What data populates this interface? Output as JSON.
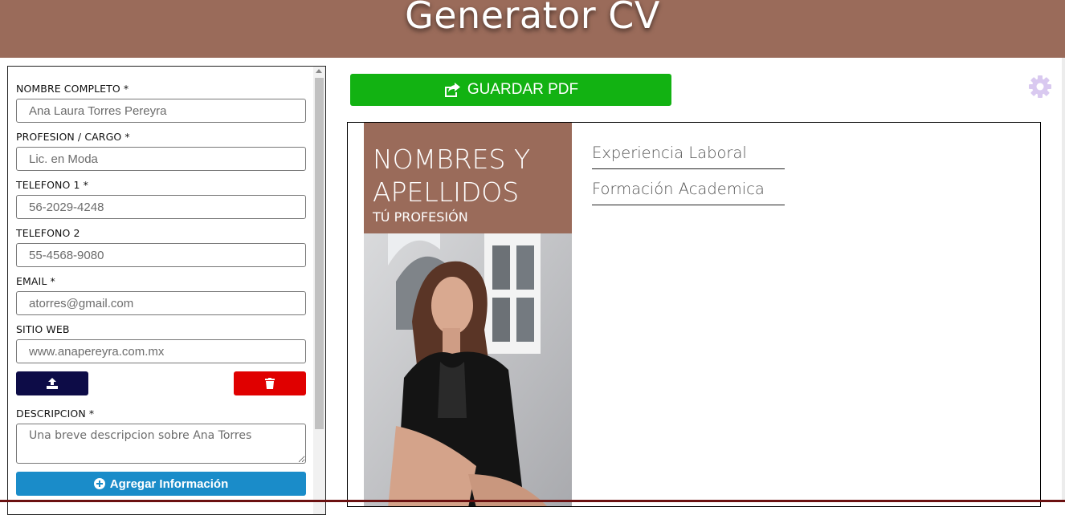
{
  "header": {
    "title": "Generator CV"
  },
  "form": {
    "fields": [
      {
        "label": "NOMBRE COMPLETO *",
        "placeholder": "Ana Laura Torres Pereyra"
      },
      {
        "label": "PROFESION / CARGO *",
        "placeholder": "Lic. en Moda"
      },
      {
        "label": "TELEFONO 1 *",
        "placeholder": "56-2029-4248"
      },
      {
        "label": "TELEFONO 2",
        "placeholder": "55-4568-9080"
      },
      {
        "label": "EMAIL *",
        "placeholder": "atorres@gmail.com"
      },
      {
        "label": "SITIO WEB",
        "placeholder": "www.anapereyra.com.mx"
      }
    ],
    "upload_icon": "upload-icon",
    "delete_icon": "trash-icon",
    "description": {
      "label": "DESCRIPCION *",
      "placeholder": "Una breve descripcion sobre Ana Torres"
    },
    "add_button": {
      "label": "Agregar Información",
      "icon": "plus-circle-icon"
    }
  },
  "toolbar": {
    "save_pdf_label": "GUARDAR PDF",
    "save_icon": "share-square-icon",
    "settings_icon": "gear-icon"
  },
  "cv": {
    "name": "NOMBRES Y APELLIDOS",
    "profession": "TÚ PROFESIÓN",
    "sections": [
      "Experiencia Laboral",
      "Formación Academica"
    ]
  },
  "colors": {
    "brand_brown": "#9a6b5a",
    "pdf_green": "#12b212",
    "upload_navy": "#0d0c47",
    "delete_red": "#e00000",
    "add_blue": "#1a8cc9",
    "gear_lavender": "#d9c9f0"
  }
}
